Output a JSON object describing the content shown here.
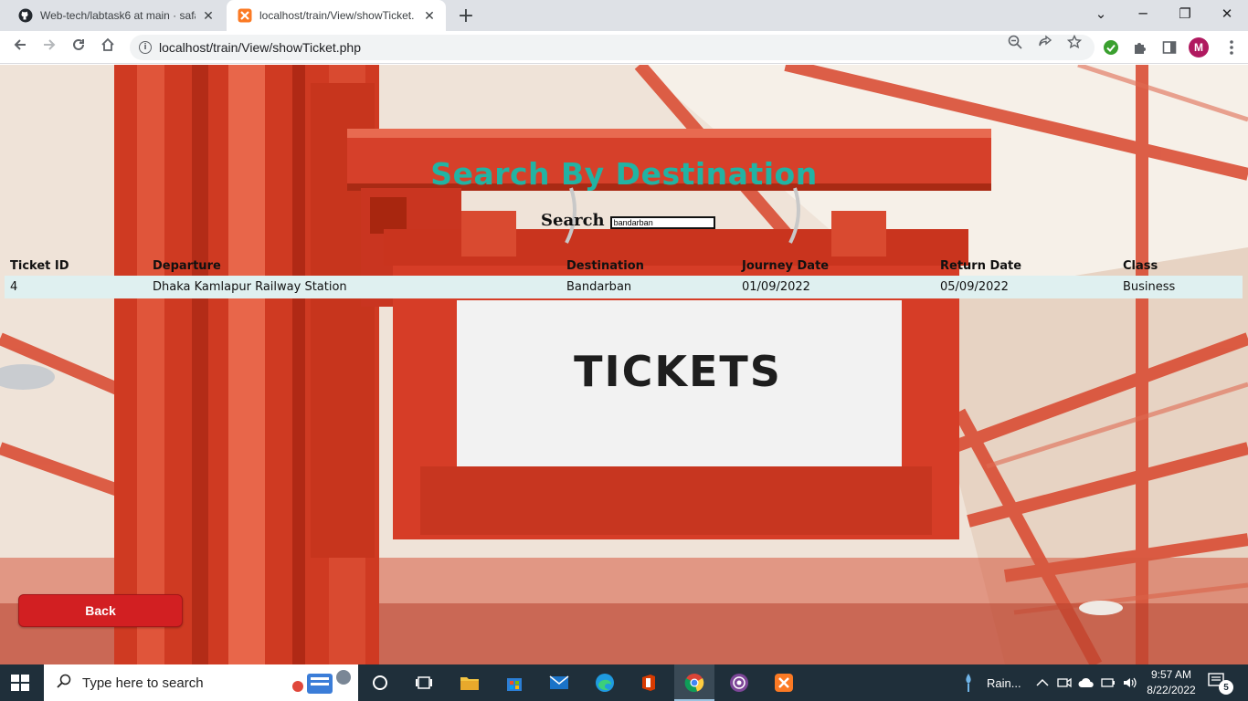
{
  "browser": {
    "tabs": [
      {
        "label": "Web-tech/labtask6 at main · safa",
        "favicon": "github-icon",
        "active": false
      },
      {
        "label": "localhost/train/View/showTicket.p",
        "favicon": "xampp-icon",
        "active": true
      }
    ],
    "close_glyph": "✕",
    "new_tab_glyph": "+",
    "address": "localhost/train/View/showTicket.php",
    "profile_initial": "M",
    "window_controls": {
      "dropdown": "⌄",
      "minimize": "─",
      "restore": "❐",
      "close": "✕"
    }
  },
  "page": {
    "heading": "Search By Destination",
    "search_label": "Search",
    "search_value": "bandarban",
    "table": {
      "headers": [
        "Ticket ID",
        "Departure",
        "Destination",
        "Journey Date",
        "Return Date",
        "Class"
      ],
      "rows": [
        [
          "4",
          "Dhaka Kamlapur Railway Station",
          "Bandarban",
          "01/09/2022",
          "05/09/2022",
          "Business"
        ]
      ]
    },
    "background_sign_text": "TICKETS",
    "back_label": "Back"
  },
  "taskbar": {
    "search_placeholder": "Type here to search",
    "weather": "Rain...",
    "time": "9:57 AM",
    "date": "8/22/2022",
    "notification_count": "5"
  },
  "colors": {
    "heading": "#22b3a3",
    "back_button": "#d21f22",
    "row_bg": "#dff0f0",
    "taskbar": "#1f2f3a"
  }
}
